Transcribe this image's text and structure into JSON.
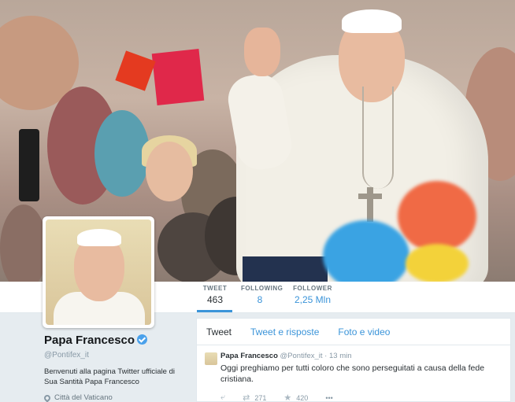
{
  "stats": {
    "tweets_label": "TWEET",
    "tweets_value": "463",
    "following_label": "FOLLOWING",
    "following_value": "8",
    "followers_label": "FOLLOWER",
    "followers_value": "2,25 Mln"
  },
  "profile": {
    "name": "Papa Francesco",
    "handle": "@Pontifex_it",
    "bio": "Benvenuti alla pagina Twitter ufficiale di Sua Santità Papa Francesco",
    "location": "Città del Vaticano"
  },
  "tabs": {
    "tweet": "Tweet",
    "replies": "Tweet e risposte",
    "media": "Foto e video"
  },
  "tweet": {
    "name": "Papa Francesco",
    "handle": "@Pontifex_it",
    "separator": "·",
    "time": "13 min",
    "text": "Oggi preghiamo per tutti coloro che sono perseguitati a causa della fede cristiana.",
    "retweets": "271",
    "favorites": "420",
    "more": "•••"
  },
  "icons": {
    "reply": "reply-icon",
    "retweet": "retweet-icon",
    "favorite": "star-icon",
    "verified": "verified-badge-icon",
    "location": "location-pin-icon"
  },
  "colors": {
    "accent": "#3b94d9",
    "verified": "#4aa1eb",
    "muted": "#8899a6"
  }
}
